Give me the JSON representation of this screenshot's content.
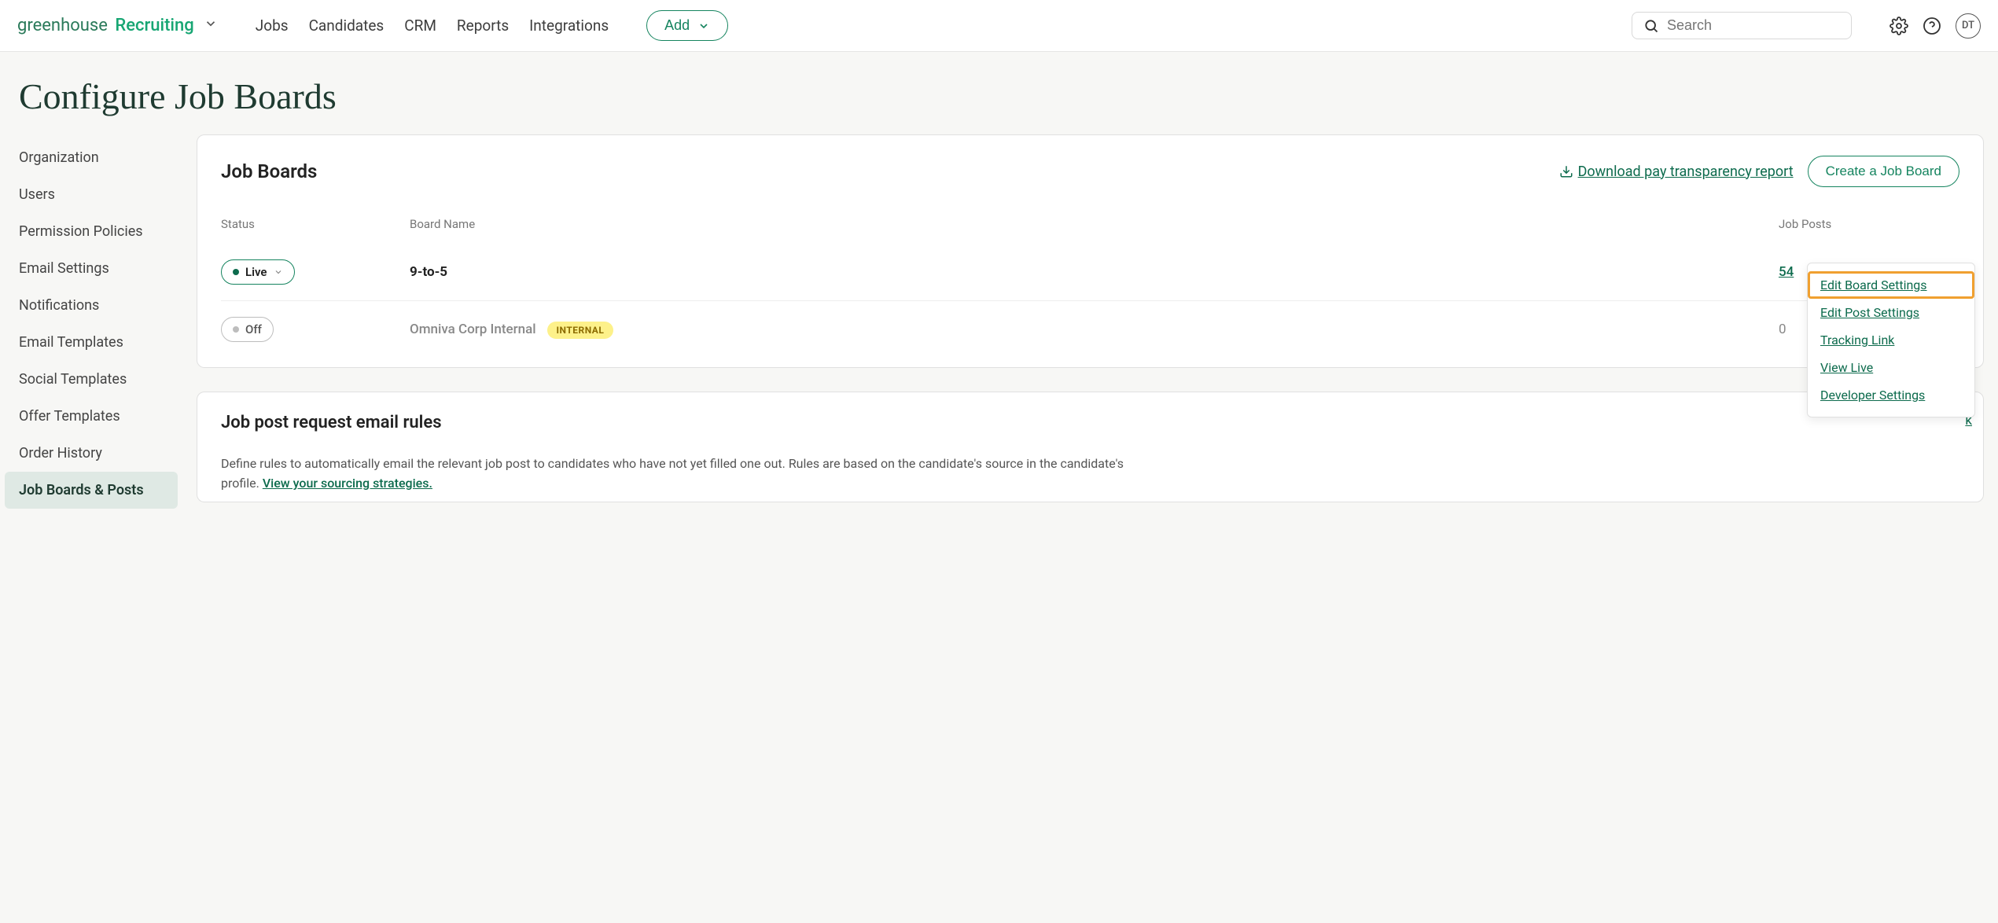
{
  "brand": {
    "text1": "greenhouse",
    "text2": "Recruiting"
  },
  "nav": {
    "items": [
      "Jobs",
      "Candidates",
      "CRM",
      "Reports",
      "Integrations"
    ],
    "add_label": "Add"
  },
  "search": {
    "placeholder": "Search"
  },
  "avatar": {
    "initials": "DT"
  },
  "page": {
    "title": "Configure Job Boards"
  },
  "sidebar": {
    "items": [
      "Organization",
      "Users",
      "Permission Policies",
      "Email Settings",
      "Notifications",
      "Email Templates",
      "Social Templates",
      "Offer Templates",
      "Order History",
      "Job Boards & Posts"
    ],
    "active_index": 9
  },
  "boards_card": {
    "title": "Job Boards",
    "download_label": "Download pay transparency report",
    "create_label": "Create a Job Board",
    "columns": {
      "status": "Status",
      "name": "Board Name",
      "posts": "Job Posts"
    },
    "rows": [
      {
        "status": "Live",
        "status_on": true,
        "name": "9-to-5",
        "internal": false,
        "posts": "54",
        "posts_link": true
      },
      {
        "status": "Off",
        "status_on": false,
        "name": "Omniva Corp Internal",
        "internal": true,
        "internal_label": "INTERNAL",
        "posts": "0",
        "posts_link": false
      }
    ]
  },
  "menu": {
    "items": [
      "Edit Board Settings",
      "Edit Post Settings",
      "Tracking Link",
      "View Live",
      "Developer Settings"
    ],
    "highlighted_index": 0
  },
  "rules_card": {
    "title": "Job post request email rules",
    "corner_link_tail": "k",
    "body_prefix": "Define rules to automatically email the relevant job post to candidates who have not yet filled one out. Rules are based on the candidate's source in the candidate's profile. ",
    "body_link": "View your sourcing strategies."
  }
}
